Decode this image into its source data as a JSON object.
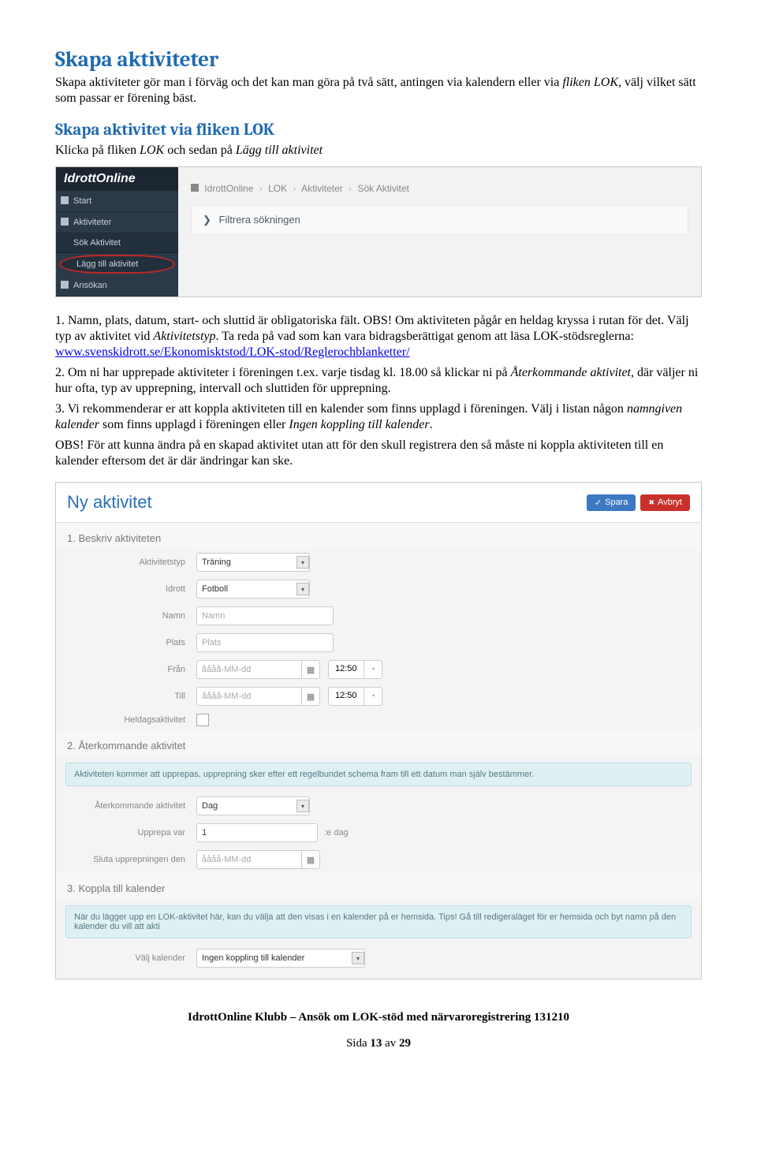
{
  "h1": "Skapa aktiviteter",
  "intro": {
    "t1": "Skapa aktiviteter gör man i förväg och det kan man göra på två sätt, antingen via kalendern eller via ",
    "t2": "fliken LOK",
    "t3": ", välj vilket sätt som passar er förening bäst."
  },
  "h2": "Skapa aktivitet via fliken LOK",
  "sub1_a": "Klicka på fliken ",
  "sub1_b": "LOK",
  "sub1_c": " och sedan på ",
  "sub1_d": "Lägg till aktivitet",
  "ss1": {
    "logo": "IdrottOnline",
    "nav": {
      "start": "Start",
      "aktiviteter": "Aktiviteter",
      "sok": "Sök Aktivitet",
      "lagg": "Lägg till aktivitet",
      "ansokan": "Ansökan"
    },
    "breadcrumb": {
      "b1": "IdrottOnline",
      "b2": "LOK",
      "b3": "Aktiviteter",
      "b4": "Sök Aktivitet"
    },
    "filter": "Filtrera sökningen"
  },
  "body": {
    "p1a": "1. Namn, plats, datum, start- och sluttid är obligatoriska fält. OBS! Om aktiviteten pågår en heldag kryssa i rutan för det. Välj typ av aktivitet vid ",
    "p1b": "Aktivitetstyp",
    "p1c": ". Ta reda på vad som kan vara bidragsberättigat genom att läsa LOK-stödsreglerna: ",
    "link": "www.svenskidrott.se/Ekonomisktstod/LOK-stod/Reglerochblanketter/",
    "p2a": "2. Om ni har upprepade aktiviteter i föreningen t.ex. varje tisdag kl. 18.00 så klickar ni på ",
    "p2b": "Återkommande aktivitet",
    "p2c": ", där väljer ni hur ofta, typ av upprepning, intervall och sluttiden för upprepning.",
    "p3a": "3. Vi rekommenderar er att koppla aktiviteten till en kalender som finns upplagd i föreningen. Välj i listan någon ",
    "p3b": "namngiven kalender",
    "p3c": " som finns upplagd i föreningen eller ",
    "p3d": "Ingen koppling till kalender",
    "p3e": ".",
    "p4": "OBS! För att kunna ändra på en skapad aktivitet utan att för den skull registrera den så måste ni koppla aktiviteten till en kalender eftersom det är där ändringar kan ske."
  },
  "ss2": {
    "title": "Ny aktivitet",
    "btn_save": "Spara",
    "btn_cancel": "Avbryt",
    "sec1": "1. Beskriv aktiviteten",
    "labels": {
      "aktivitetstyp": "Aktivitetstyp",
      "idrott": "Idrott",
      "namn": "Namn",
      "plats": "Plats",
      "fran": "Från",
      "till": "Till",
      "heldag": "Heldagsaktivitet",
      "aterkommande": "Återkommande aktivitet",
      "upprepa": "Upprepa var",
      "sluta": "Sluta upprepningen den",
      "valj": "Välj kalender"
    },
    "values": {
      "aktivitetstyp": "Träning",
      "idrott": "Fotboll",
      "namn_ph": "Namn",
      "plats_ph": "Plats",
      "date_ph": "åååå-MM-dd",
      "time": "12:50",
      "dag": "Dag",
      "ett": "1",
      "edag": ":e dag",
      "ingen": "Ingen koppling till kalender"
    },
    "sec2": "2. Återkommande aktivitet",
    "info2": "Aktiviteten kommer att upprepas, upprepning sker efter ett regelbundet schema fram till ett datum man själv bestämmer.",
    "sec3": "3. Koppla till kalender",
    "info3": "När du lägger upp en LOK-aktivitet här, kan du välja att den visas i en kalender på er hemsida. Tips! Gå till redigeraläget för er hemsida och byt namn på den kalender du vill att akti"
  },
  "footer": "IdrottOnline Klubb – Ansök om LOK-stöd med närvaroregistrering 131210",
  "page": {
    "a": "Sida ",
    "b": "13",
    "c": " av ",
    "d": "29"
  }
}
